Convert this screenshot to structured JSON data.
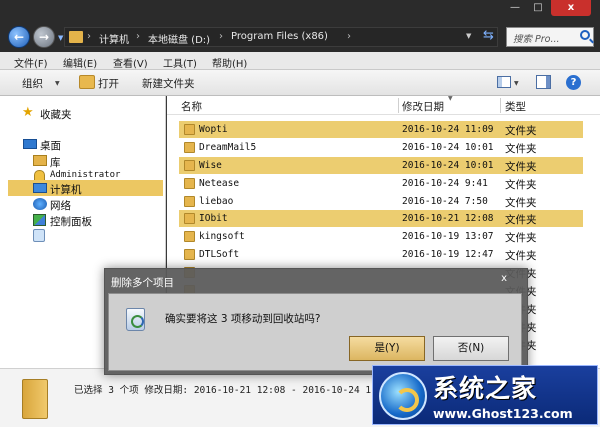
{
  "window": {
    "controls": {
      "minimize": "—",
      "maximize": "□",
      "close": "x"
    }
  },
  "address": {
    "crumbs": [
      "计算机",
      "本地磁盘 (D:)",
      "Program Files (x86)"
    ],
    "separator": "›",
    "search_placeholder": "搜索 Pro..."
  },
  "menu": [
    "文件(F)",
    "编辑(E)",
    "查看(V)",
    "工具(T)",
    "帮助(H)"
  ],
  "toolbar": {
    "organize": "组织",
    "open": "打开",
    "new_folder": "新建文件夹"
  },
  "nav": {
    "favorites": "收藏夹",
    "desktop": "桌面",
    "libraries": "库",
    "user": "Administrator",
    "computer": "计算机",
    "network": "网络",
    "control_panel": "控制面板"
  },
  "columns": {
    "name": "名称",
    "date": "修改日期",
    "type": "类型"
  },
  "files": [
    {
      "name": "Wopti",
      "date": "2016-10-24 11:09",
      "type": "文件夹"
    },
    {
      "name": "DreamMail5",
      "date": "2016-10-24 10:01",
      "type": "文件夹"
    },
    {
      "name": "Wise",
      "date": "2016-10-24 10:01",
      "type": "文件夹"
    },
    {
      "name": "Netease",
      "date": "2016-10-24 9:41",
      "type": "文件夹"
    },
    {
      "name": "liebao",
      "date": "2016-10-24 7:50",
      "type": "文件夹"
    },
    {
      "name": "IObit",
      "date": "2016-10-21 12:08",
      "type": "文件夹"
    },
    {
      "name": "kingsoft",
      "date": "2016-10-19 13:07",
      "type": "文件夹"
    },
    {
      "name": "DTLSoft",
      "date": "2016-10-19 12:47",
      "type": "文件夹"
    },
    {
      "name": "",
      "date": "",
      "type": "文件夹"
    },
    {
      "name": "",
      "date": "",
      "type": "文件夹"
    },
    {
      "name": "",
      "date": "",
      "type": "文件夹"
    },
    {
      "name": "",
      "date": "",
      "type": "文件夹"
    },
    {
      "name": "",
      "date": "",
      "type": "文件夹"
    }
  ],
  "status": {
    "details": "已选择 3 个项 修改日期: 2016-10-21 12:08 - 2016-10-24 11:"
  },
  "dialog": {
    "title": "删除多个项目",
    "close": "x",
    "message": "确实要将这 3 项移动到回收站吗?",
    "yes": "是(Y)",
    "no": "否(N)"
  },
  "watermark": {
    "title": "系统之家",
    "url": "www.Ghost123.com"
  }
}
